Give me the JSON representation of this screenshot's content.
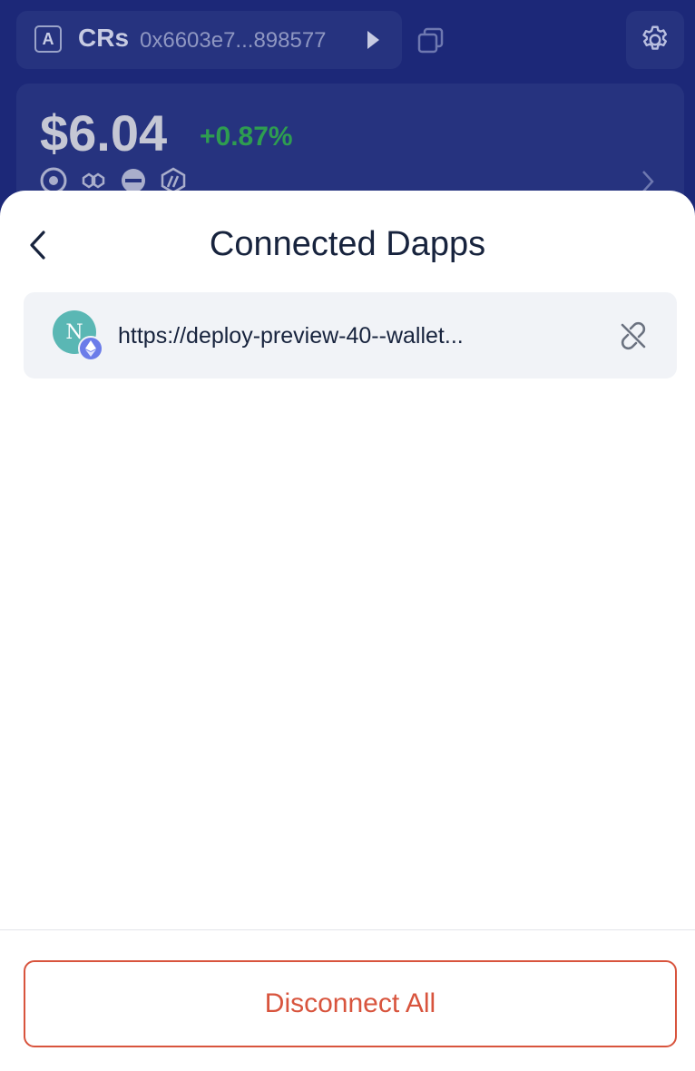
{
  "wallet": {
    "account_badge": "A",
    "account_name": "CRs",
    "address": "0x6603e7...898577",
    "balance": "$6.04",
    "change": "+0.87%",
    "chains": [
      "optimism-icon",
      "polygon-icon",
      "zksync-icon",
      "arbitrum-icon"
    ]
  },
  "sheet": {
    "title": "Connected Dapps",
    "dapps": [
      {
        "avatar_letter": "N",
        "url": "https://deploy-preview-40--wallet...",
        "network_icon": "ethereum-icon"
      }
    ],
    "disconnect_all_label": "Disconnect All"
  },
  "colors": {
    "header_bg": "#1c2878",
    "positive": "#2e9d50",
    "danger": "#d8543d",
    "title": "#17233d"
  }
}
